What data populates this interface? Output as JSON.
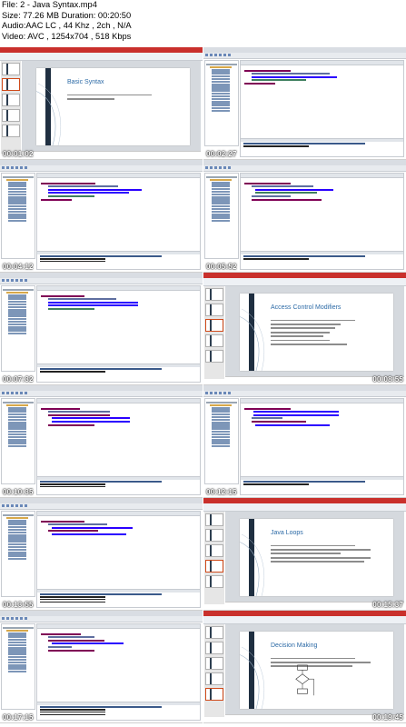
{
  "header": {
    "file": "File: 2 - Java Syntax.mp4",
    "size": "Size: 77.26 MB Duration: 00:20:50",
    "audio": "Audio:AAC LC , 44 Khz , 2ch , N/A",
    "video": "Video: AVC , 1254x704 , 518 Kbps"
  },
  "tiles": [
    {
      "kind": "slide",
      "title": "Basic Syntax",
      "timestamp": "00:01:02"
    },
    {
      "kind": "eclipse",
      "timestamp": "00:02:27"
    },
    {
      "kind": "eclipse",
      "timestamp": "00:04:12"
    },
    {
      "kind": "eclipse",
      "timestamp": "00:05:52"
    },
    {
      "kind": "eclipse",
      "timestamp": "00:07:32"
    },
    {
      "kind": "slide",
      "title": "Access Control Modifiers",
      "timestamp": "00:08:55"
    },
    {
      "kind": "eclipse",
      "timestamp": "00:10:35"
    },
    {
      "kind": "eclipse",
      "timestamp": "00:12:15"
    },
    {
      "kind": "eclipse",
      "timestamp": "00:13:55"
    },
    {
      "kind": "slide",
      "title": "Java Loops",
      "timestamp": "00:15:37"
    },
    {
      "kind": "eclipse",
      "timestamp": "00:17:15"
    },
    {
      "kind": "slide",
      "title": "Decision Making",
      "timestamp": "00:19:45"
    }
  ],
  "colors": {
    "ppt_titlebar": "#c9302c",
    "slide_bar": "#1f2f41",
    "slide_title": "#2c6aa6",
    "eclipse_chrome": "#d9dde3"
  }
}
